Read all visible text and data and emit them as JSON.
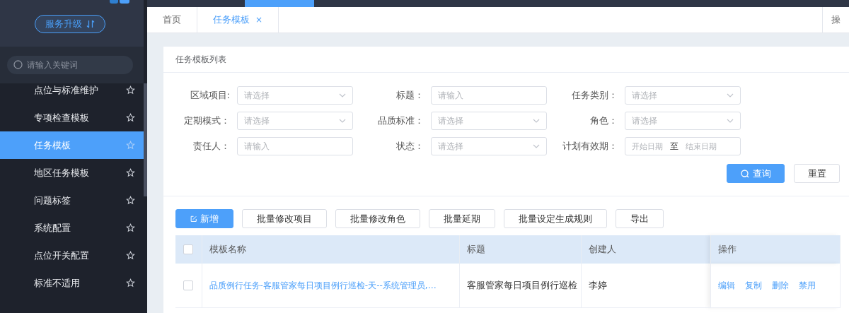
{
  "sidebar": {
    "upgrade_button": "服务升级",
    "search": {
      "placeholder": "请输入关键词"
    },
    "items": [
      {
        "label": "点位与标准维护",
        "selected": false
      },
      {
        "label": "专项检查模板",
        "selected": false
      },
      {
        "label": "任务模板",
        "selected": true
      },
      {
        "label": "地区任务模板",
        "selected": false
      },
      {
        "label": "问题标签",
        "selected": false
      },
      {
        "label": "系统配置",
        "selected": false
      },
      {
        "label": "点位开关配置",
        "selected": false
      },
      {
        "label": "标准不适用",
        "selected": false
      }
    ]
  },
  "tabs": [
    {
      "label": "首页",
      "selected": false,
      "closable": false
    },
    {
      "label": "任务模板",
      "selected": true,
      "closable": true
    }
  ],
  "tab_close": "×",
  "right_tab": "操",
  "card": {
    "title": "任务模板列表",
    "filters": [
      {
        "label": "区域项目:",
        "kind": "select",
        "placeholder": "请选择"
      },
      {
        "label": "标题：",
        "kind": "input",
        "placeholder": "请输入"
      },
      {
        "label": "任务类别：",
        "kind": "select",
        "placeholder": "请选择"
      },
      {
        "label": "定期模式：",
        "kind": "select",
        "placeholder": "请选择"
      },
      {
        "label": "品质标准：",
        "kind": "select",
        "placeholder": "请选择"
      },
      {
        "label": "角色：",
        "kind": "select",
        "placeholder": "请选择"
      },
      {
        "label": "责任人：",
        "kind": "input",
        "placeholder": "请输入"
      },
      {
        "label": "状态：",
        "kind": "select",
        "placeholder": "请选择"
      },
      {
        "label": "计划有效期：",
        "kind": "daterange",
        "start_placeholder": "开始日期",
        "separator": "至",
        "end_placeholder": "结束日期"
      }
    ],
    "search_button": "查询",
    "reset_button": "重置",
    "toolbar": [
      {
        "label": "新增",
        "kind": "primary"
      },
      {
        "label": "批量修改项目",
        "kind": "default"
      },
      {
        "label": "批量修改角色",
        "kind": "default"
      },
      {
        "label": "批量延期",
        "kind": "default"
      },
      {
        "label": "批量设定生成规则",
        "kind": "default"
      },
      {
        "label": "导出",
        "kind": "default"
      }
    ],
    "table": {
      "header_checked": false,
      "columns": [
        "模板名称",
        "标题",
        "创建人",
        "操作"
      ],
      "rows": [
        {
          "checked": false,
          "name": "品质例行任务-客服管家每日项目例行巡检-天--系统管理员,…",
          "title": "客服管家每日项目例行巡检",
          "creator": "李婷",
          "actions": [
            "编辑",
            "复制",
            "删除",
            "禁用"
          ]
        }
      ]
    }
  }
}
